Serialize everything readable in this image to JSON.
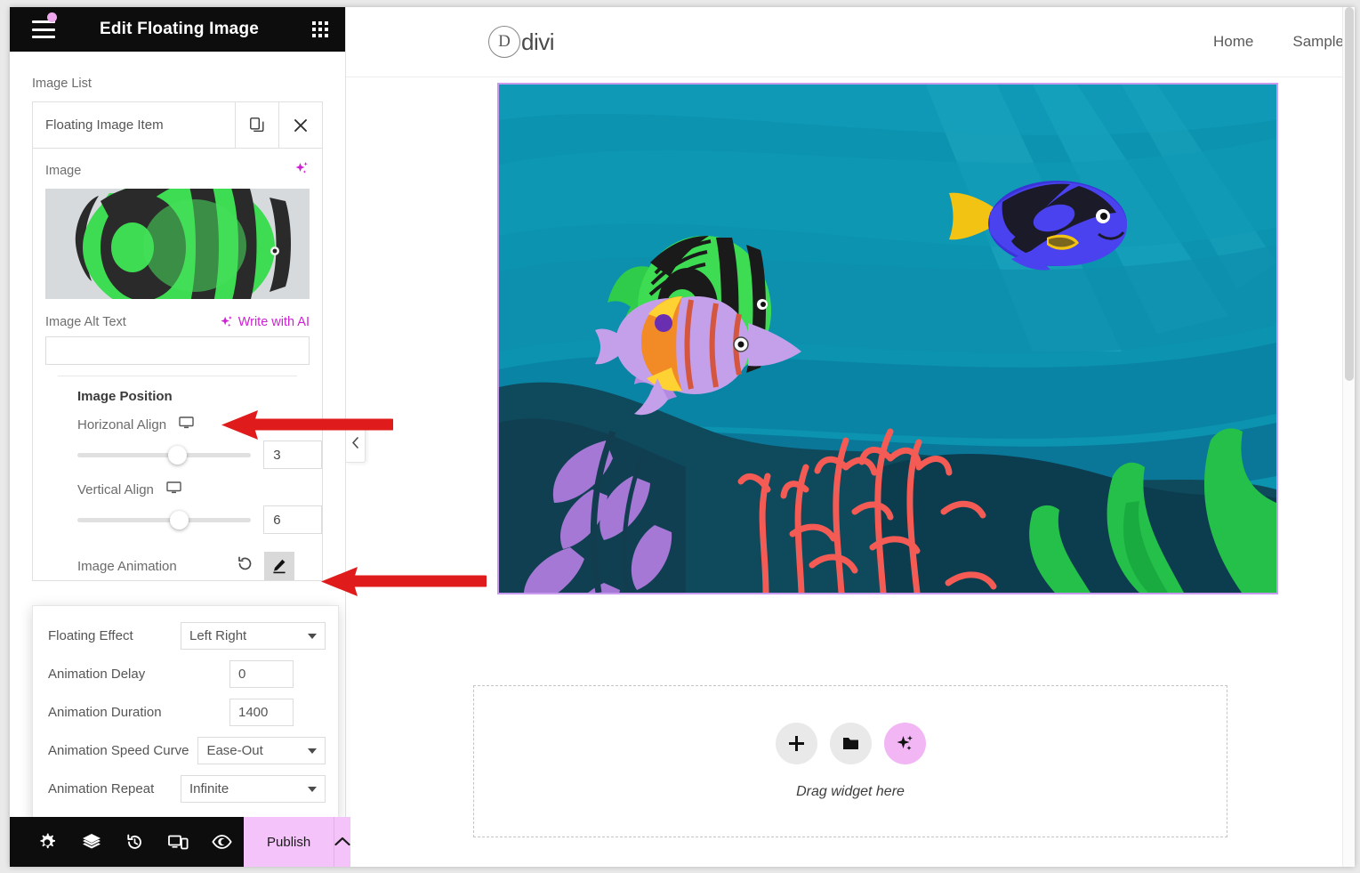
{
  "panel": {
    "title": "Edit Floating Image",
    "menu_icon": "hamburger-icon",
    "apps_icon": "grid-apps-icon",
    "section_label": "Image List",
    "list_item": {
      "name": "Floating Image Item",
      "duplicate_icon": "duplicate-icon",
      "remove_icon": "close-icon"
    },
    "image_field": {
      "label": "Image",
      "ai_icon": "sparkle-icon"
    },
    "alt_text": {
      "label": "Image Alt Text",
      "ai_link": "Write with AI",
      "value": "",
      "placeholder": ""
    },
    "image_position": {
      "group_title": "Image Position",
      "horizontal": {
        "label": "Horizonal Align",
        "device_icon": "desktop-icon",
        "value": "3",
        "slider_percent": 50
      },
      "vertical": {
        "label": "Vertical Align",
        "device_icon": "desktop-icon",
        "value": "6",
        "slider_percent": 51
      }
    },
    "image_animation": {
      "label": "Image Animation",
      "reset_icon": "reset-icon",
      "edit_icon": "pencil-icon"
    },
    "collapse_icon": "chevron-left-icon"
  },
  "popover": {
    "rows": [
      {
        "label": "Floating Effect",
        "type": "select",
        "value": "Left Right"
      },
      {
        "label": "Animation Delay",
        "type": "input",
        "value": "0"
      },
      {
        "label": "Animation Duration",
        "type": "input",
        "value": "1400"
      },
      {
        "label": "Animation Speed Curve",
        "type": "select",
        "value": "Ease-Out"
      },
      {
        "label": "Animation Repeat",
        "type": "select",
        "value": "Infinite"
      }
    ]
  },
  "bottombar": {
    "icons": [
      {
        "name": "settings-gear-icon"
      },
      {
        "name": "layers-navigator-icon"
      },
      {
        "name": "history-icon"
      },
      {
        "name": "responsive-device-icon"
      },
      {
        "name": "preview-eye-icon"
      }
    ],
    "publish_label": "Publish",
    "publish_caret_icon": "chevron-up-icon",
    "accent_color": "#f4c3f9"
  },
  "site": {
    "logo_letter": "D",
    "logo_text": "divi",
    "nav": [
      "Home",
      "Sample"
    ]
  },
  "canvas": {
    "hero_alt": "underwater scene with tropical fish, coral and seaweed",
    "dropzone": {
      "buttons": [
        {
          "name": "add-element-button",
          "icon": "plus-icon"
        },
        {
          "name": "add-template-button",
          "icon": "folder-icon"
        },
        {
          "name": "ai-generate-button",
          "icon": "sparkle-icon"
        }
      ],
      "text": "Drag widget here"
    }
  },
  "annotations": {
    "color": "#e01b1b",
    "arrows": [
      {
        "name": "arrow-to-image-position",
        "points_to": "Image Position"
      },
      {
        "name": "arrow-to-edit-animation",
        "points_to": "Image Animation edit button"
      }
    ]
  },
  "colors": {
    "panel_header_bg": "#0d0d0d",
    "accent_pink": "#f4c3f9",
    "ai_purple": "#cd22d1",
    "hero_outline": "#c99bf0"
  }
}
